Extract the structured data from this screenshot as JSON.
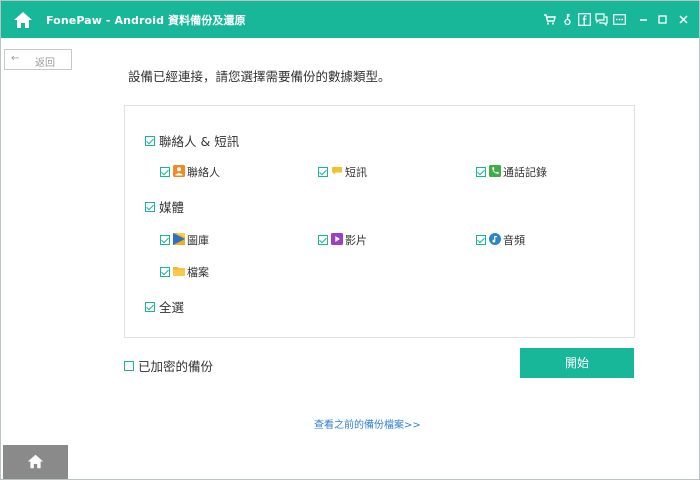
{
  "app": {
    "title": "FonePaw - Android 資料備份及還原"
  },
  "titlebar": {
    "icons": [
      "home-icon",
      "cart-icon",
      "key-icon",
      "facebook-icon",
      "feedback-icon",
      "menu-icon",
      "minimize-icon",
      "maximize-icon",
      "close-icon"
    ],
    "color": "#18b79a"
  },
  "back_button": {
    "arrow": "←",
    "label": "返回"
  },
  "heading": "設備已經連接，請您選擇需要備份的數據類型。",
  "groups": [
    {
      "label": "聯絡人 & 短訊",
      "checked": true,
      "items": [
        {
          "label": "聯絡人",
          "icon": "contacts-icon",
          "checked": true
        },
        {
          "label": "短訊",
          "icon": "message-icon",
          "checked": true
        },
        {
          "label": "通話記錄",
          "icon": "phone-icon",
          "checked": true
        }
      ]
    },
    {
      "label": "媒體",
      "checked": true,
      "items": [
        {
          "label": "圖庫",
          "icon": "gallery-icon",
          "checked": true
        },
        {
          "label": "影片",
          "icon": "video-icon",
          "checked": true
        },
        {
          "label": "音頻",
          "icon": "audio-icon",
          "checked": true
        },
        {
          "label": "檔案",
          "icon": "folder-icon",
          "checked": true
        }
      ]
    }
  ],
  "select_all": {
    "label": "全選",
    "checked": true
  },
  "encrypt": {
    "label": "已加密的備份",
    "checked": false
  },
  "start_button": {
    "label": "開始"
  },
  "history_link": "查看之前的備份檔案>>",
  "colors": {
    "accent": "#18b79a",
    "link": "#2f7fd6"
  }
}
